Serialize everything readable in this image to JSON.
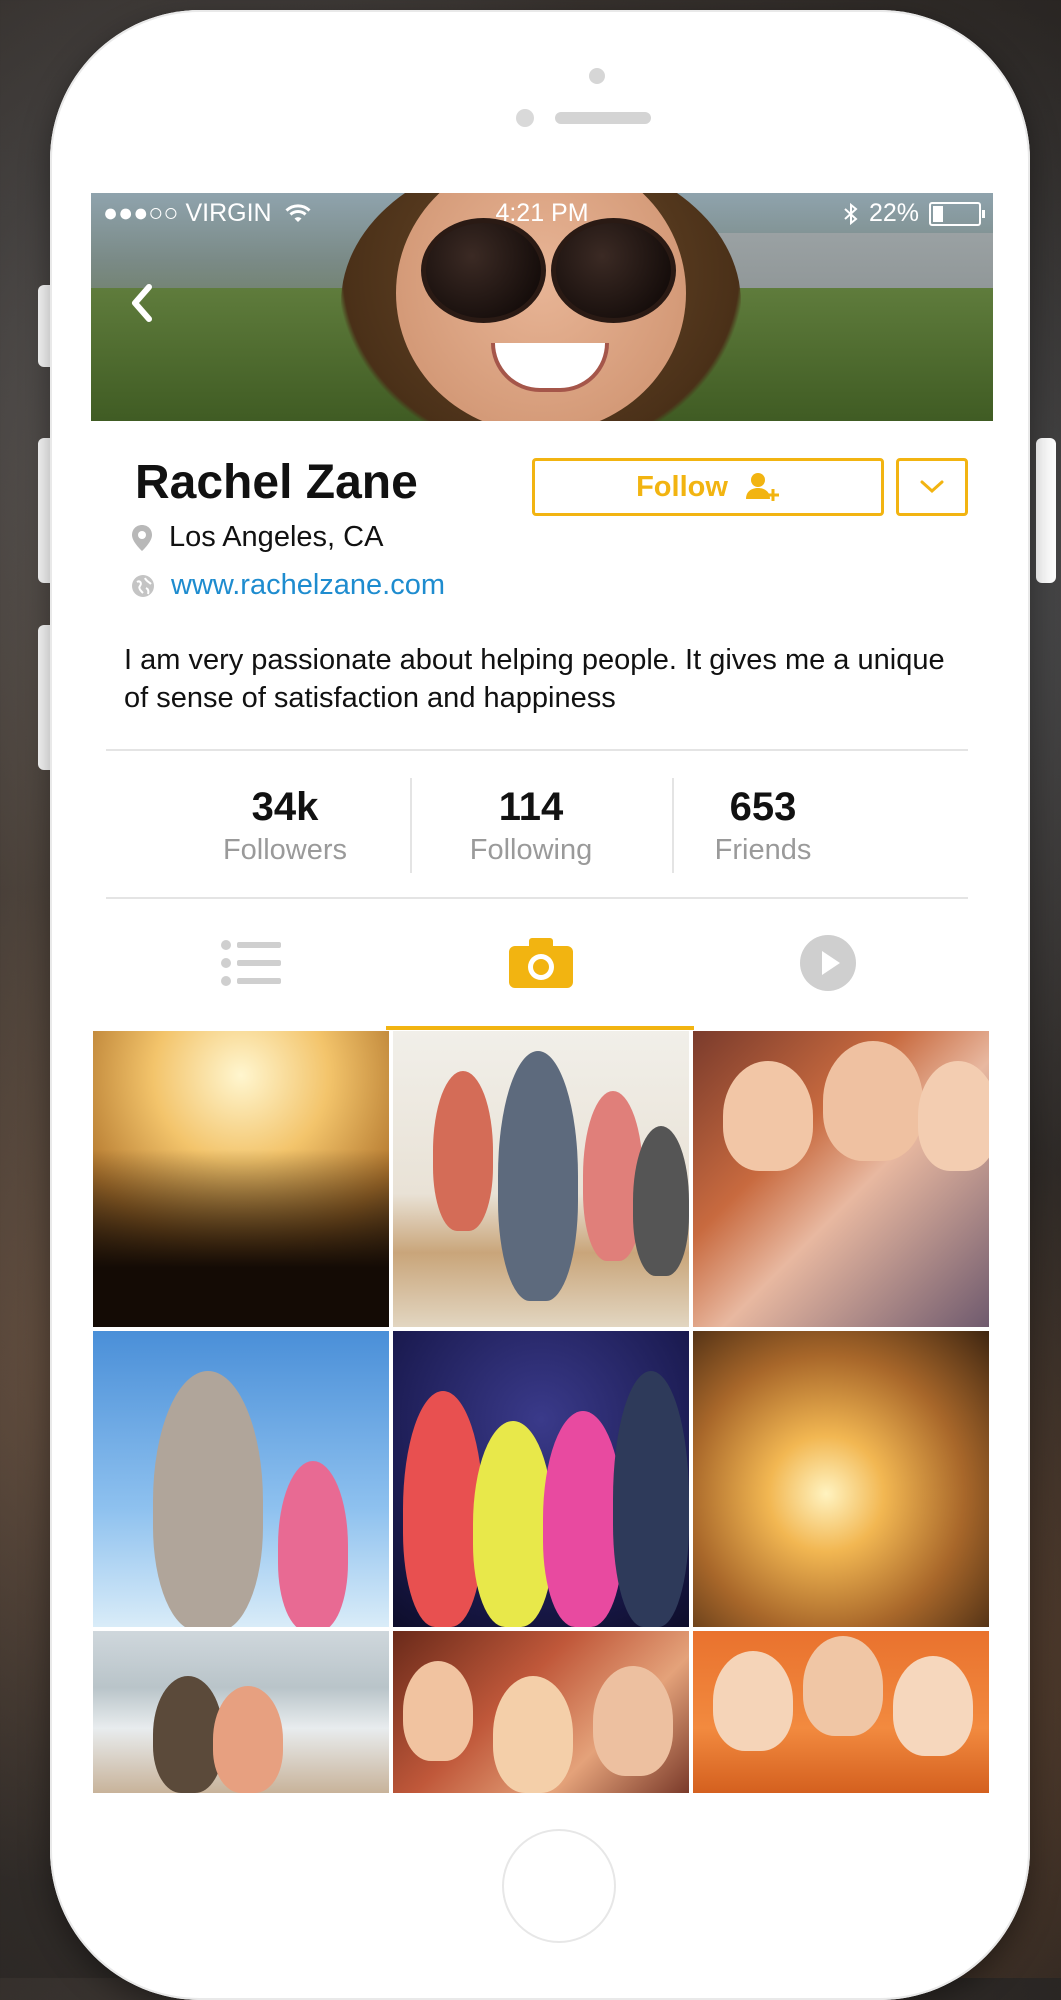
{
  "status_bar": {
    "carrier": "●●●○○ VIRGIN",
    "time": "4:21 PM",
    "battery": "22%",
    "battery_level": 0.22
  },
  "profile": {
    "name": "Rachel Zane",
    "location": "Los Angeles, CA",
    "website": "www.rachelzane.com",
    "bio": "I am very passionate about helping people. It gives me a unique of sense of satisfaction and happiness"
  },
  "actions": {
    "follow_label": "Follow"
  },
  "stats": [
    {
      "value": "34k",
      "label": "Followers"
    },
    {
      "value": "114",
      "label": "Following"
    },
    {
      "value": "653",
      "label": "Friends"
    }
  ],
  "tabs": [
    {
      "icon": "list-icon",
      "active": false
    },
    {
      "icon": "camera-icon",
      "active": true
    },
    {
      "icon": "play-icon",
      "active": false
    }
  ],
  "colors": {
    "accent": "#f2b411",
    "link": "#1e8ccf",
    "muted": "#9a9a9a"
  }
}
